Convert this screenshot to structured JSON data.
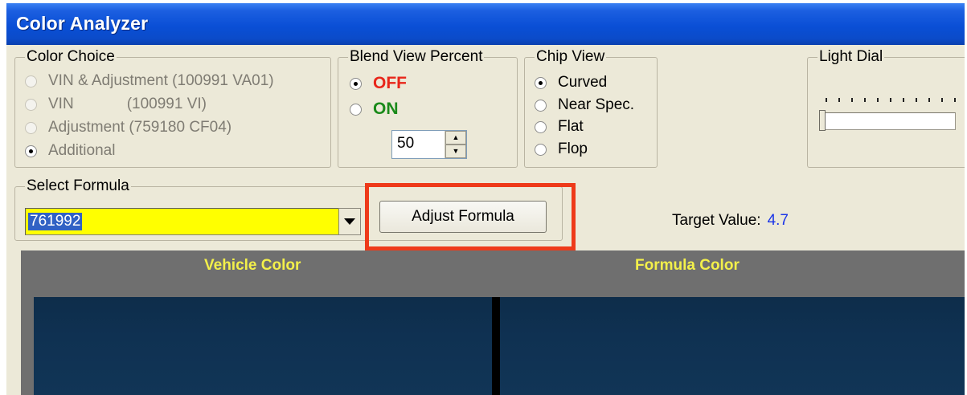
{
  "window": {
    "title": "Color Analyzer"
  },
  "color_choice": {
    "legend": "Color Choice",
    "options": [
      {
        "label": "VIN & Adjustment (100991 VA01)",
        "selected": false,
        "enabled": false
      },
      {
        "label": "VIN",
        "code": "(100991 VI)",
        "selected": false,
        "enabled": false
      },
      {
        "label": "Adjustment (759180 CF04)",
        "selected": false,
        "enabled": false
      },
      {
        "label": "Additional",
        "selected": true,
        "enabled": false
      }
    ]
  },
  "blend_view": {
    "legend": "Blend View Percent",
    "off_label": "OFF",
    "on_label": "ON",
    "selected": "OFF",
    "percent": "50",
    "colors": {
      "off": "#e8261a",
      "on": "#1a8a1a"
    }
  },
  "chip_view": {
    "legend": "Chip View",
    "options": [
      {
        "label": "Curved",
        "selected": true
      },
      {
        "label": "Near Spec.",
        "selected": false
      },
      {
        "label": "Flat",
        "selected": false
      },
      {
        "label": "Flop",
        "selected": false
      }
    ]
  },
  "light_dial": {
    "legend": "Light Dial",
    "level": 0
  },
  "select_formula": {
    "legend": "Select Formula",
    "value": "761992"
  },
  "adjust_button": {
    "label": "Adjust Formula",
    "highlight_color": "#ee3a1a"
  },
  "target": {
    "label": "Target Value:",
    "value": "4.7"
  },
  "preview": {
    "vehicle_label": "Vehicle Color",
    "formula_label": "Formula Color",
    "header_color": "#f3f04a",
    "vehicle_swatch": "#0f3152",
    "formula_swatch": "#113556"
  }
}
